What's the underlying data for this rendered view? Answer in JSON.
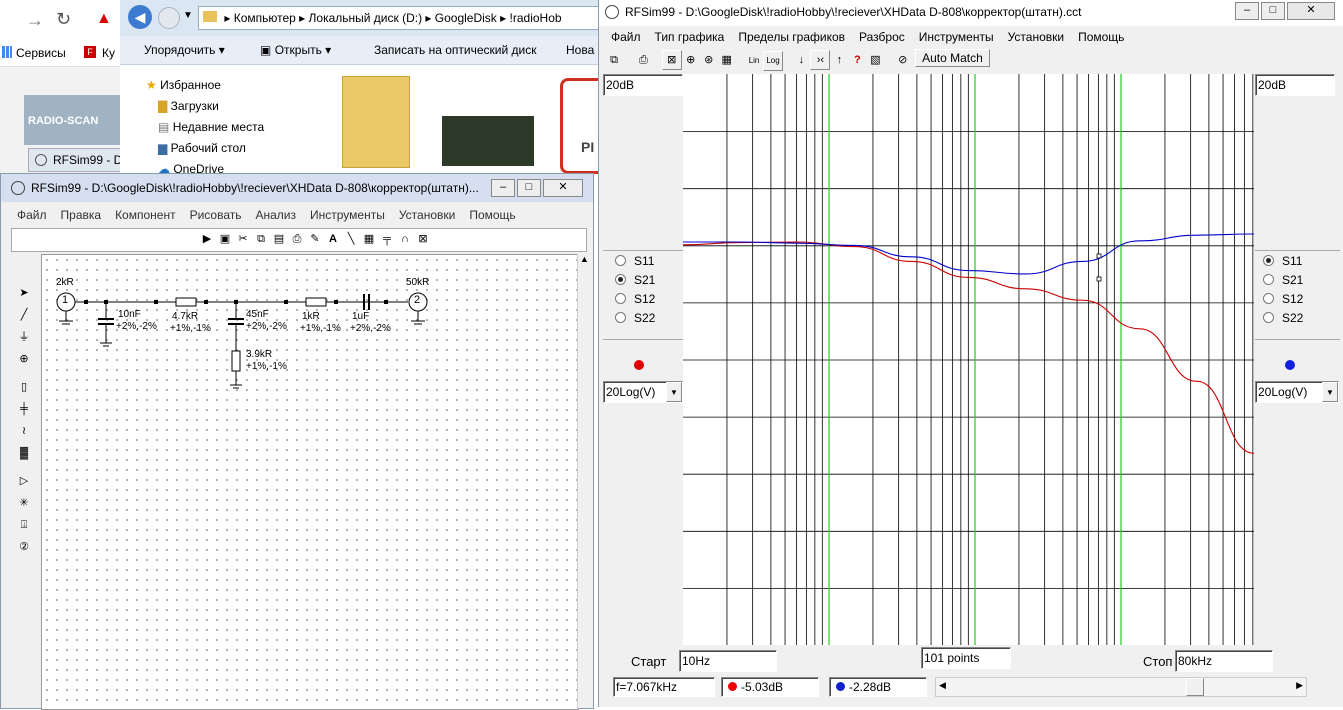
{
  "browser": {
    "bookmarks_label": "Сервисы",
    "bookmark2": "Ку"
  },
  "explorer": {
    "breadcrumb": [
      "Компьютер",
      "Локальный диск (D:)",
      "GoogleDisk",
      "!radioHob"
    ],
    "toolbar": [
      "Упорядочить",
      "Открыть",
      "Записать на оптический диск",
      "Нова"
    ],
    "nav": [
      "Избранное",
      "Загрузки",
      "Недавние места",
      "Рабочий стол",
      "OneDrive"
    ],
    "logo_text": "RADIO-SCAN",
    "pdf_label": "PI"
  },
  "rfsim_back_tab": "RFSim99 - D",
  "schematic": {
    "title": "RFSim99 - D:\\GoogleDisk\\!radioHobby\\!reciever\\XHData D-808\\корректор(штатн)...",
    "menu": [
      "Файл",
      "Правка",
      "Компонент",
      "Рисовать",
      "Анализ",
      "Инструменты",
      "Установки",
      "Помощь"
    ],
    "components": {
      "port1": "1",
      "port1_res": "2kR",
      "port2": "2",
      "port2_res": "50kR",
      "c1": "10nF",
      "c1_tol": "+2%,-2%",
      "r1": "4.7kR",
      "r1_tol": "+1%,-1%",
      "c2": "45nF",
      "c2_tol": "+2%,-2%",
      "r2": "3.9kR",
      "r2_tol": "+1%,-1%",
      "r3": "1kR",
      "r3_tol": "+1%,-1%",
      "c3": "1uF",
      "c3_tol": "+2%,-2%"
    }
  },
  "graph": {
    "title": "RFSim99 - D:\\GoogleDisk\\!radioHobby\\!reciever\\XHData D-808\\корректор(штатн).cct",
    "menu": [
      "Файл",
      "Тип графика",
      "Пределы графиков",
      "Разброс",
      "Инструменты",
      "Установки",
      "Помощь"
    ],
    "auto_match": "Auto Match",
    "left_scale": "20dB",
    "right_scale": "20dB",
    "left_params": [
      "S11",
      "S21",
      "S12",
      "S22"
    ],
    "left_selected": 1,
    "right_params": [
      "S11",
      "S21",
      "S12",
      "S22"
    ],
    "right_selected": 0,
    "left_mode": "20Log(V)",
    "right_mode": "20Log(V)",
    "start_label": "Старт",
    "start_value": "10Hz",
    "points_value": "101 points",
    "stop_label": "Стоп",
    "stop_value": "80kHz",
    "status_freq": "f=7.067kHz",
    "status_red": "-5.03dB",
    "status_blue": "-2.28dB",
    "red_color": "#cc0000",
    "blue_color": "#0000cc"
  },
  "chart_data": {
    "type": "line",
    "xlabel": "",
    "ylabel": "",
    "x_range_labels": [
      "10Hz",
      "80kHz"
    ],
    "y_scale_label": "20dB",
    "marker": {
      "x": "7.067kHz",
      "series_values": [
        -5.03,
        -2.28
      ]
    },
    "series": [
      {
        "color": "#cc0000",
        "norm_points": [
          [
            0,
            -0.05
          ],
          [
            0.1,
            -0.01
          ],
          [
            0.2,
            0.0
          ],
          [
            0.3,
            -0.08
          ],
          [
            0.4,
            -0.34
          ],
          [
            0.5,
            -0.62
          ],
          [
            0.6,
            -0.82
          ],
          [
            0.7,
            -1.02
          ],
          [
            0.8,
            -1.52
          ],
          [
            0.9,
            -2.44
          ],
          [
            1.0,
            -3.7
          ]
        ]
      },
      {
        "color": "#0000cc",
        "norm_points": [
          [
            0,
            0.0
          ],
          [
            0.1,
            0.0
          ],
          [
            0.2,
            -0.02
          ],
          [
            0.3,
            -0.06
          ],
          [
            0.4,
            -0.26
          ],
          [
            0.5,
            -0.5
          ],
          [
            0.6,
            -0.56
          ],
          [
            0.7,
            -0.34
          ],
          [
            0.8,
            0.02
          ],
          [
            0.9,
            0.12
          ],
          [
            1.0,
            0.14
          ]
        ]
      }
    ]
  }
}
